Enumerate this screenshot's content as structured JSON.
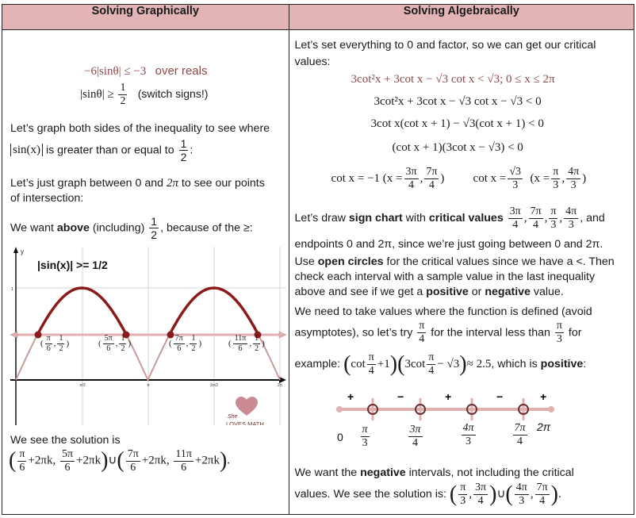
{
  "headers": {
    "left": "Solving Graphically",
    "right": "Solving Algebraically"
  },
  "left": {
    "problem": "−6|sinθ| ≤ −3",
    "problem_note": "over reals",
    "step1_lhs": "|sinθ| ≥",
    "step1_frac": {
      "n": "1",
      "d": "2"
    },
    "step1_note": "(switch signs!)",
    "p1_line1": "Let’s graph both sides of the inequality to see where",
    "p1_abs": "sin(x)",
    "p1_line2": "is greater than or equal to",
    "p1_frac": {
      "n": "1",
      "d": "2"
    },
    "p1_end": ":",
    "p2": "Let’s just graph between 0 and 2π to see our points of intersection:",
    "p2_line1": "Let’s just graph between 0 and",
    "p2_two_pi": "2π",
    "p2_line1b": "to see our points",
    "p2_line2": "of intersection:",
    "p3_pre": "We want",
    "p3_bold": "above",
    "p3_mid": "(including)",
    "p3_frac": {
      "n": "1",
      "d": "2"
    },
    "p3_end": ", because of the ≥:",
    "graph": {
      "title": "|sin(x)| >= 1/2",
      "y_axis_label": "y",
      "y_tick": "1",
      "x_ticks": [
        "π/2",
        "π",
        "3π/2",
        "2π"
      ],
      "points": [
        {
          "label_n": "π",
          "label_d": "6"
        },
        {
          "label_n": "5π",
          "label_d": "6"
        },
        {
          "label_n": "7π",
          "label_d": "6"
        },
        {
          "label_n": "11π",
          "label_d": "6"
        }
      ],
      "point_y": {
        "n": "1",
        "d": "2"
      },
      "watermark_line1": "She",
      "watermark_line2": "LOVES MATH",
      "colors": {
        "curve_above": "#8b1a1a",
        "curve_below": "#c99a9a",
        "line_half": "#e0b0b0"
      }
    },
    "solution_intro": "We see the solution is",
    "solution": {
      "a_n": "π",
      "a_d": "6",
      "a_k": "+2πk,",
      "b_n": "5π",
      "b_d": "6",
      "b_k": "+2πk",
      "c_n": "7π",
      "c_d": "6",
      "c_k": "+2πk,",
      "d_n": "11π",
      "d_d": "6",
      "d_k": "+2πk",
      "union": "∪",
      "end": "."
    }
  },
  "right": {
    "intro_line1": "Let’s set everything to 0 and factor, so we can get our critical",
    "intro_line2": "values:",
    "eq1": "3cot²x + 3cot x − √3 cot x < √3;   0 ≤ x ≤ 2π",
    "eq2": "3cot²x + 3cot x − √3 cot x − √3 < 0",
    "eq3": "3cot x(cot x + 1) − √3(cot x + 1) < 0",
    "eq4": "(cot x + 1)(3cot x − √3) < 0",
    "sol1_pre": "cot x = −1  (x =",
    "sol1_f1": {
      "n": "3π",
      "d": "4"
    },
    "sol1_f2": {
      "n": "7π",
      "d": "4"
    },
    "sol2_pre": "cot x =",
    "sol2_f": {
      "n": "√3",
      "d": "3"
    },
    "sol2_mid": "(x =",
    "sol2_f1": {
      "n": "π",
      "d": "3"
    },
    "sol2_f2": {
      "n": "4π",
      "d": "3"
    },
    "p1_pre": "Let’s draw",
    "p1_b1": "sign chart",
    "p1_mid": "with",
    "p1_b2": "critical values",
    "p1_fracs": [
      {
        "n": "3π",
        "d": "4"
      },
      {
        "n": "7π",
        "d": "4"
      },
      {
        "n": "π",
        "d": "3"
      },
      {
        "n": "4π",
        "d": "3"
      }
    ],
    "p1_end": ", and",
    "p1_line2": "endpoints 0 and 2π, since we’re just going between 0 and 2π.",
    "p1_line3_pre": "Use",
    "p1_line3_b": "open circles",
    "p1_line3_post": "for the critical values since we have a <.  Then",
    "p1_line4": "check each interval with a sample value in the last inequality",
    "p1_line5_pre": "above and see if we get a",
    "p1_line5_b1": "positive",
    "p1_line5_mid": "or",
    "p1_line5_b2": "negative",
    "p1_line5_post": "value.",
    "p2_line1": "We need to take values where the function is defined (avoid",
    "p2_line2_pre": "asymptotes), so let’s try",
    "p2_f1": {
      "n": "π",
      "d": "4"
    },
    "p2_line2_mid": "for the interval less than",
    "p2_f2": {
      "n": "π",
      "d": "3"
    },
    "p2_line2_post": "for",
    "p2_line3_pre": "example:",
    "p2_expr": "(cot π/4 + 1)(3cot π/4 − √3) ≈ 2.5",
    "p2_expr_a": "cot",
    "p2_expr_a2": "+1",
    "p2_expr_b": "3cot",
    "p2_expr_b2": "− √3",
    "p2_expr_frac": {
      "n": "π",
      "d": "4"
    },
    "p2_approx": "≈ 2.5",
    "p2_line3_post": ", which is",
    "p2_line3_b": "positive",
    "p2_line3_end": ":",
    "sign_chart": {
      "start": "0",
      "end": "2π",
      "critical": [
        {
          "n": "π",
          "d": "3"
        },
        {
          "n": "3π",
          "d": "4"
        },
        {
          "n": "4π",
          "d": "3"
        },
        {
          "n": "7π",
          "d": "4"
        }
      ],
      "signs": [
        "+",
        "−",
        "+",
        "−",
        "+"
      ],
      "colors": {
        "line": "#e0b0b0",
        "circle": "#6b3030"
      }
    },
    "p3_pre": "We want the",
    "p3_b": "negative",
    "p3_post": "intervals, not including the critical",
    "p3_line2": "values. We see the solution is:",
    "final": {
      "a": {
        "n": "π",
        "d": "3"
      },
      "b": {
        "n": "3π",
        "d": "4"
      },
      "c": {
        "n": "4π",
        "d": "3"
      },
      "d": {
        "n": "7π",
        "d": "4"
      },
      "union": "∪",
      "end": "."
    }
  }
}
